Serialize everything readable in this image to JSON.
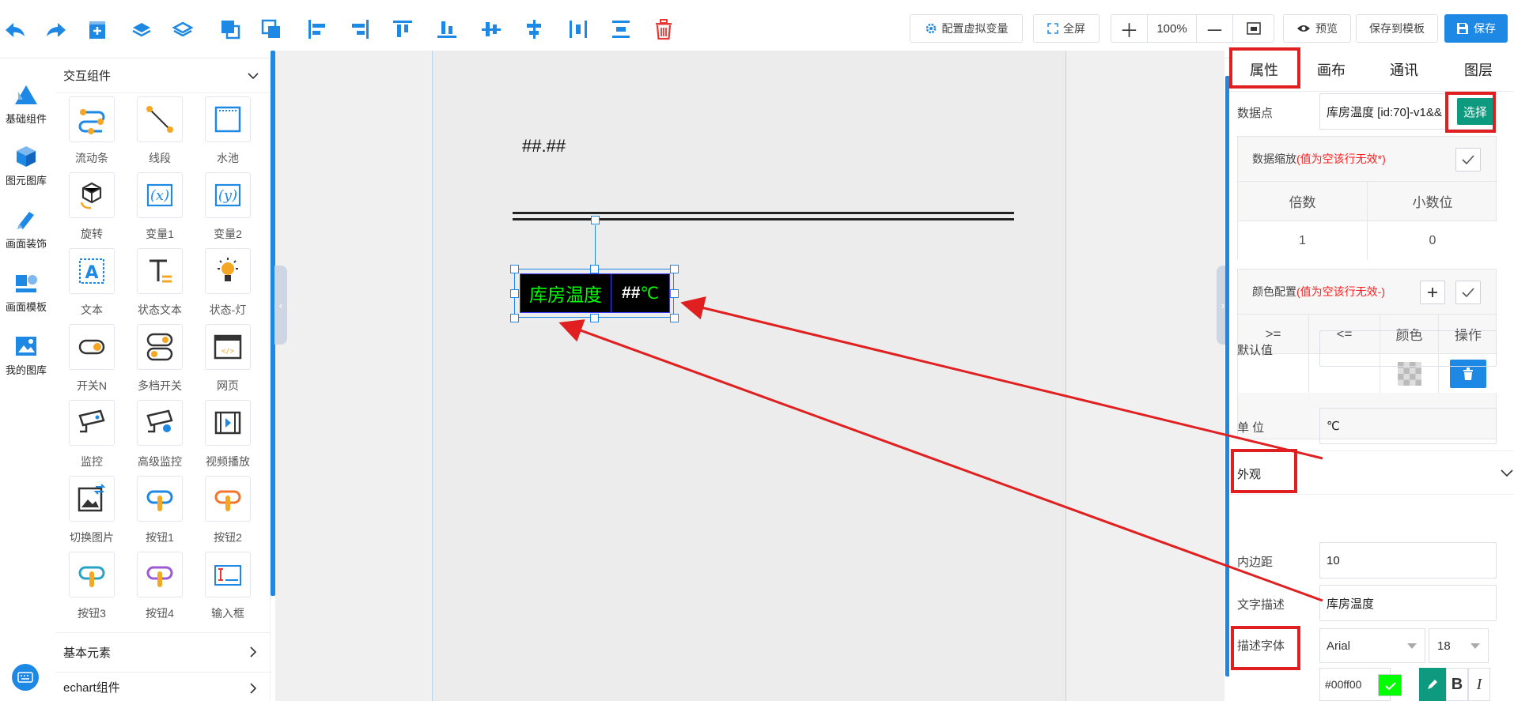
{
  "toolbar": {
    "virtual_var_label": "配置虚拟变量",
    "fullscreen_label": "全屏",
    "zoom_value": "100%",
    "preview_label": "预览",
    "save_template_label": "保存到模板",
    "save_label": "保存"
  },
  "categories": [
    {
      "label": "基础组件",
      "icon": "triangle-icon"
    },
    {
      "label": "图元图库",
      "icon": "cube-icon"
    },
    {
      "label": "画面装饰",
      "icon": "brush-icon"
    },
    {
      "label": "画面模板",
      "icon": "template-icon"
    },
    {
      "label": "我的图库",
      "icon": "image-icon"
    }
  ],
  "component_panel": {
    "section_title": "交互组件",
    "items": [
      "流动条",
      "线段",
      "水池",
      "旋转",
      "变量1",
      "变量2",
      "文本",
      "状态文本",
      "状态-灯",
      "开关N",
      "多档开关",
      "网页",
      "监控",
      "高级监控",
      "视频播放",
      "切换图片",
      "按钮1",
      "按钮2",
      "按钮3",
      "按钮4",
      "输入框"
    ],
    "footer_sections": [
      "基本元素",
      "echart组件"
    ]
  },
  "canvas": {
    "hash_text": "##.##",
    "widget_label": "库房温度",
    "widget_value": "##",
    "widget_unit": "℃"
  },
  "properties": {
    "tabs": [
      "属性",
      "画布",
      "通讯",
      "图层"
    ],
    "data_point_label": "数据点",
    "data_point_value": "库房温度 [id:70]-v1&&",
    "select_label": "选择",
    "scale_title": "数据缩放",
    "scale_note": "(值为空该行无效*)",
    "scale_headers": [
      "倍数",
      "小数位"
    ],
    "scale_values": [
      "1",
      "0"
    ],
    "color_title": "颜色配置",
    "color_note": "(值为空该行无效-)",
    "color_headers": [
      ">=",
      "<=",
      "颜色",
      "操作"
    ],
    "default_label": "默认值",
    "default_value": "",
    "unit_label": "单 位",
    "unit_value": "℃",
    "appearance_label": "外观",
    "padding_label": "内边距",
    "padding_value": "10",
    "text_desc_label": "文字描述",
    "text_desc_value": "库房温度",
    "desc_font_label": "描述字体",
    "font_value": "Arial",
    "size_value": "18",
    "color_value": "#00ff00",
    "bold_label": "B",
    "italic_label": "I"
  },
  "colors": {
    "accent": "#1e88e5",
    "pick_button": "#0e9a7e",
    "widget_text": "#00ff00",
    "annotation": "#e02020"
  }
}
